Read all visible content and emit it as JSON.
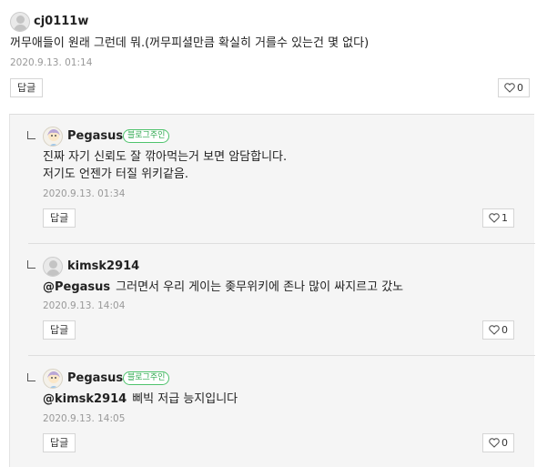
{
  "main_comment": {
    "author": "cj0111w",
    "content": "꺼무애들이 원래 그런데 뭐.(꺼무피셜만큼 확실히 거를수 있는건 몇 없다)",
    "date": "2020.9.13. 01:14",
    "reply_label": "답글",
    "like_count": "0"
  },
  "replies": [
    {
      "author": "Pegasus",
      "badge": "블로그주인",
      "lines": [
        "진짜 자기 신뢰도 잘 깎아먹는거 보면 암담합니다.",
        "저기도 언젠가 터질 위키같음."
      ],
      "date": "2020.9.13. 01:34",
      "reply_label": "답글",
      "like_count": "1"
    },
    {
      "author": "kimsk2914",
      "mention": "@Pegasus",
      "content": "그러면서 우리 게이는 좆무위키에 존나 많이 싸지르고 갔노",
      "date": "2020.9.13. 14:04",
      "reply_label": "답글",
      "like_count": "0"
    },
    {
      "author": "Pegasus",
      "badge": "블로그주인",
      "mention": "@kimsk2914",
      "content": "삐빅 저급 능지입니다",
      "date": "2020.9.13. 14:05",
      "reply_label": "답글",
      "like_count": "0"
    }
  ],
  "icons": {
    "like": "heart-outline-icon",
    "avatar_default": "default-user-icon",
    "avatar_blogger": "character-avatar-icon"
  },
  "colors": {
    "badge_green": "#2fa84f",
    "date_gray": "#999999",
    "reply_bg": "#f5f5f5"
  }
}
